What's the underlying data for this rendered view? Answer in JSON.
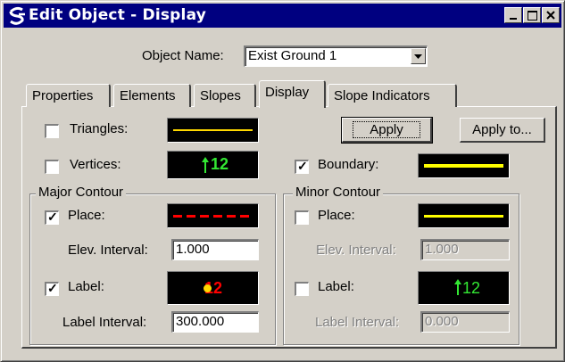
{
  "window": {
    "title": "Edit Object - Display",
    "icon": "app-s-logo-icon",
    "controls": [
      "minimize-icon",
      "maximize-icon",
      "close-icon"
    ]
  },
  "object_name": {
    "label": "Object Name:",
    "value": "Exist Ground 1"
  },
  "tabs": [
    {
      "label": "Properties",
      "active": false
    },
    {
      "label": "Elements",
      "active": false
    },
    {
      "label": "Slopes",
      "active": false
    },
    {
      "label": "Display",
      "active": true
    },
    {
      "label": "Slope Indicators",
      "active": false
    }
  ],
  "display": {
    "triangles": {
      "label": "Triangles:",
      "checked": false,
      "swatch_color": "#ffd800"
    },
    "vertices": {
      "label": "Vertices:",
      "checked": false,
      "swatch_text": "12",
      "swatch_color": "#33e833"
    },
    "boundary": {
      "label": "Boundary:",
      "checked": true,
      "swatch_color": "#ffff00"
    },
    "apply_label": "Apply",
    "apply_to_label": "Apply to...",
    "major": {
      "title": "Major Contour",
      "place_label": "Place:",
      "place_checked": true,
      "place_color": "#ff0000",
      "elev_label": "Elev. Interval:",
      "elev_value": "1.000",
      "label_label": "Label:",
      "label_checked": true,
      "label_swatch_text": "12",
      "label_color": "#ff0000",
      "label_interval_label": "Label Interval:",
      "label_interval_value": "300.000"
    },
    "minor": {
      "title": "Minor Contour",
      "place_label": "Place:",
      "place_checked": false,
      "place_color": "#ffff00",
      "elev_label": "Elev. Interval:",
      "elev_value": "1.000",
      "label_label": "Label:",
      "label_checked": false,
      "label_swatch_text": "12",
      "label_color": "#33e833",
      "label_interval_label": "Label Interval:",
      "label_interval_value": "0.000"
    }
  }
}
